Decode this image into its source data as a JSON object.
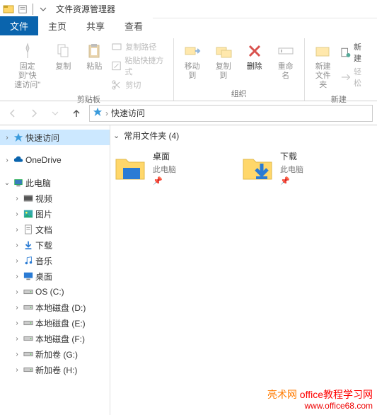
{
  "titlebar": {
    "title": "文件资源管理器"
  },
  "tabs": [
    {
      "label": "文件",
      "active": true
    },
    {
      "label": "主页",
      "active": false
    },
    {
      "label": "共享",
      "active": false
    },
    {
      "label": "查看",
      "active": false
    }
  ],
  "ribbon": {
    "groups": [
      {
        "label": "剪贴板",
        "pin": {
          "label": "固定到\"快\n速访问\""
        },
        "copy": {
          "label": "复制"
        },
        "paste": {
          "label": "粘贴"
        },
        "copypath": {
          "label": "复制路径"
        },
        "shortcut": {
          "label": "粘贴快捷方式"
        },
        "cut": {
          "label": "剪切"
        }
      },
      {
        "label": "组织",
        "move": {
          "label": "移动到"
        },
        "copyTo": {
          "label": "复制到"
        },
        "delete": {
          "label": "删除"
        },
        "rename": {
          "label": "重命名"
        }
      },
      {
        "label": "新建",
        "newFolder": {
          "label": "新建\n文件夹"
        },
        "newItem": {
          "label": "新建"
        },
        "easy": {
          "label": "轻松"
        }
      }
    ]
  },
  "nav": {
    "location": "快速访问"
  },
  "tree": {
    "quick": "快速访问",
    "onedrive": "OneDrive",
    "thispc": "此电脑",
    "items": [
      {
        "icon": "video",
        "label": "视频"
      },
      {
        "icon": "picture",
        "label": "图片"
      },
      {
        "icon": "document",
        "label": "文档"
      },
      {
        "icon": "download",
        "label": "下载"
      },
      {
        "icon": "music",
        "label": "音乐"
      },
      {
        "icon": "desktop",
        "label": "桌面"
      },
      {
        "icon": "drive",
        "label": "OS (C:)"
      },
      {
        "icon": "drive",
        "label": "本地磁盘 (D:)"
      },
      {
        "icon": "drive",
        "label": "本地磁盘 (E:)"
      },
      {
        "icon": "drive",
        "label": "本地磁盘 (F:)"
      },
      {
        "icon": "drive",
        "label": "新加卷 (G:)"
      },
      {
        "icon": "drive",
        "label": "新加卷 (H:)"
      }
    ]
  },
  "content": {
    "header": "常用文件夹 (4)",
    "folders": [
      {
        "name": "桌面",
        "sub": "此电脑",
        "type": "desktop"
      },
      {
        "name": "下载",
        "sub": "此电脑",
        "type": "download"
      }
    ]
  },
  "watermark": {
    "line1a": "亮术网",
    "line1b": "office教程学习网",
    "line2": "www.office68.com"
  }
}
